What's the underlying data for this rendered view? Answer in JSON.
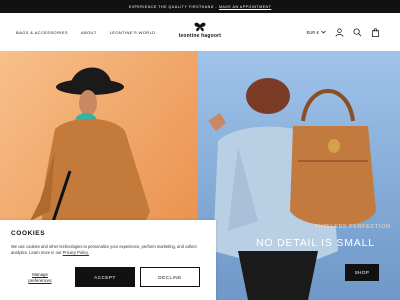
{
  "announcement": {
    "text": "EXPERIENCE THE QUALITY FIRSTHAND -",
    "link": "MAKE AN APPOINTMENT"
  },
  "nav": {
    "items": [
      "BAGS & ACCESSORIES",
      "ABOUT",
      "LEONTINE'S WORLD"
    ]
  },
  "logo": {
    "text": "leontine hagoort"
  },
  "header_right": {
    "currency": "EUR €",
    "icons": [
      "account-icon",
      "search-icon",
      "bag-icon"
    ]
  },
  "hero": {
    "tagline": "TIMELESS PERFECTION",
    "headline": "NO DETAIL IS SMALL",
    "cta": "SHOP"
  },
  "cookie": {
    "title": "COOKIES",
    "text_before_link": "We use cookies and other technologies to personalize your experience, perform marketing, and collect analytics. Learn more in our ",
    "link": "Privacy Policy.",
    "manage_line1": "Manage",
    "manage_line2": "preferences",
    "accept": "ACCEPT",
    "decline": "DECLINE"
  },
  "colors": {
    "announce_bg": "#111111",
    "hero_left_bg": "#f2a868",
    "hero_right_bg": "#8db6e3",
    "button_dark": "#111111"
  }
}
